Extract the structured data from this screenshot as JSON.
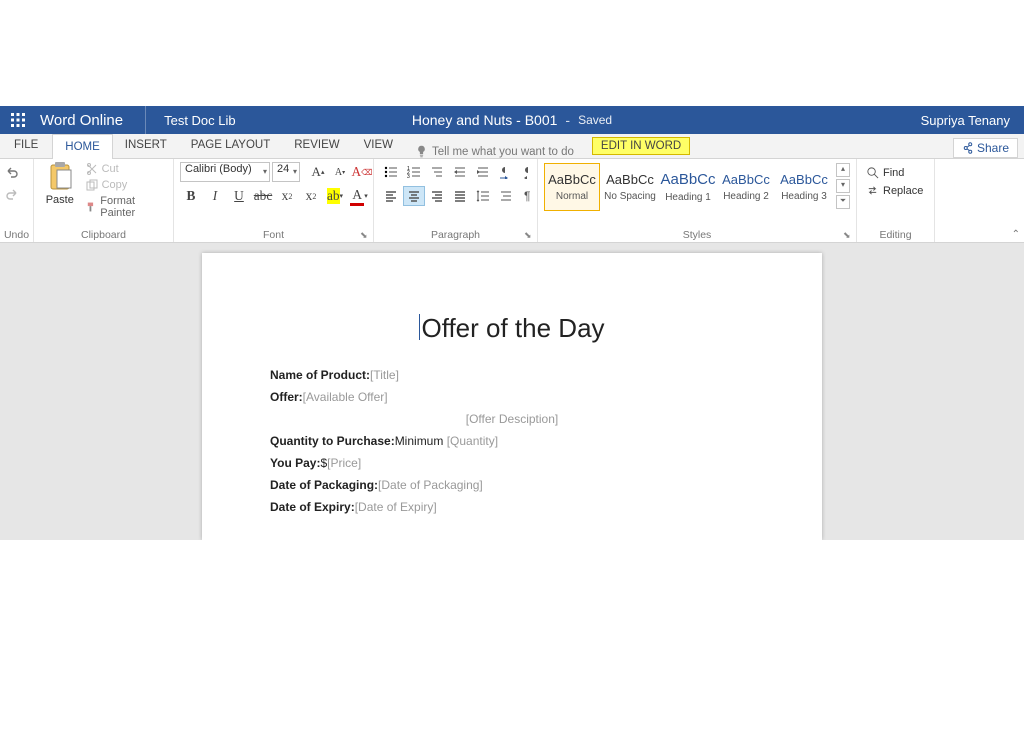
{
  "titlebar": {
    "brand": "Word Online",
    "library": "Test Doc Lib",
    "docTitle": "Honey and Nuts - B001",
    "status": "Saved",
    "user": "Supriya Tenany"
  },
  "tabs": {
    "file": "FILE",
    "home": "HOME",
    "insert": "INSERT",
    "pageLayout": "PAGE LAYOUT",
    "review": "REVIEW",
    "view": "VIEW",
    "tellMe": "Tell me what you want to do",
    "editInWord": "EDIT IN WORD",
    "share": "Share"
  },
  "ribbon": {
    "undoLabel": "Undo",
    "clipboard": {
      "paste": "Paste",
      "cut": "Cut",
      "copy": "Copy",
      "formatPainter": "Format Painter",
      "label": "Clipboard"
    },
    "font": {
      "name": "Calibri (Body)",
      "size": "24",
      "label": "Font"
    },
    "paragraph": {
      "label": "Paragraph"
    },
    "styles": {
      "sample": "AaBbCc",
      "normal": "Normal",
      "noSpacing": "No Spacing",
      "heading1": "Heading 1",
      "heading2": "Heading 2",
      "heading3": "Heading 3",
      "label": "Styles"
    },
    "editing": {
      "find": "Find",
      "replace": "Replace",
      "label": "Editing"
    }
  },
  "doc": {
    "heading": "Offer of the Day",
    "l1a": "Name of Product:",
    "l1b": "[Title]",
    "l2a": "Offer:",
    "l2b": "[Available Offer]",
    "l3": "[Offer Desciption]",
    "l4a": "Quantity to Purchase:",
    "l4b": "Minimum ",
    "l4c": "[Quantity]",
    "l5a": "You Pay:",
    "l5b": "$",
    "l5c": "[Price]",
    "l6a": "Date of Packaging:",
    "l6b": "[Date of Packaging]",
    "l7a": "Date of Expiry:",
    "l7b": "[Date of Expiry]"
  }
}
